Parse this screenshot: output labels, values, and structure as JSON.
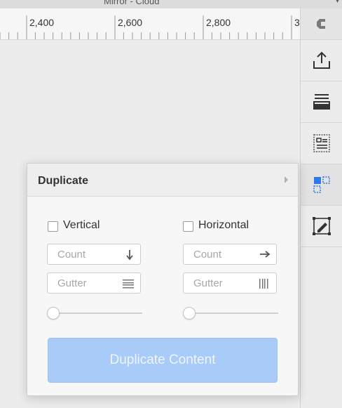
{
  "window": {
    "title": "Mirror - Cloud"
  },
  "ruler": {
    "labels": [
      "2,400",
      "2,600",
      "2,800",
      "3"
    ]
  },
  "sidebar": {
    "buttons": [
      {
        "name": "logo-icon"
      },
      {
        "name": "export-icon"
      },
      {
        "name": "layers-icon"
      },
      {
        "name": "layout-icon"
      },
      {
        "name": "duplicate-icon"
      },
      {
        "name": "transform-icon"
      }
    ]
  },
  "panel": {
    "title": "Duplicate",
    "vertical": {
      "label": "Vertical",
      "checked": false,
      "count_placeholder": "Count",
      "gutter_placeholder": "Gutter",
      "slider_value": 0
    },
    "horizontal": {
      "label": "Horizontal",
      "checked": false,
      "count_placeholder": "Count",
      "gutter_placeholder": "Gutter",
      "slider_value": 0
    },
    "action_label": "Duplicate Content"
  },
  "colors": {
    "accent": "#2f7ae5",
    "button_disabled": "#a8cbf8"
  }
}
